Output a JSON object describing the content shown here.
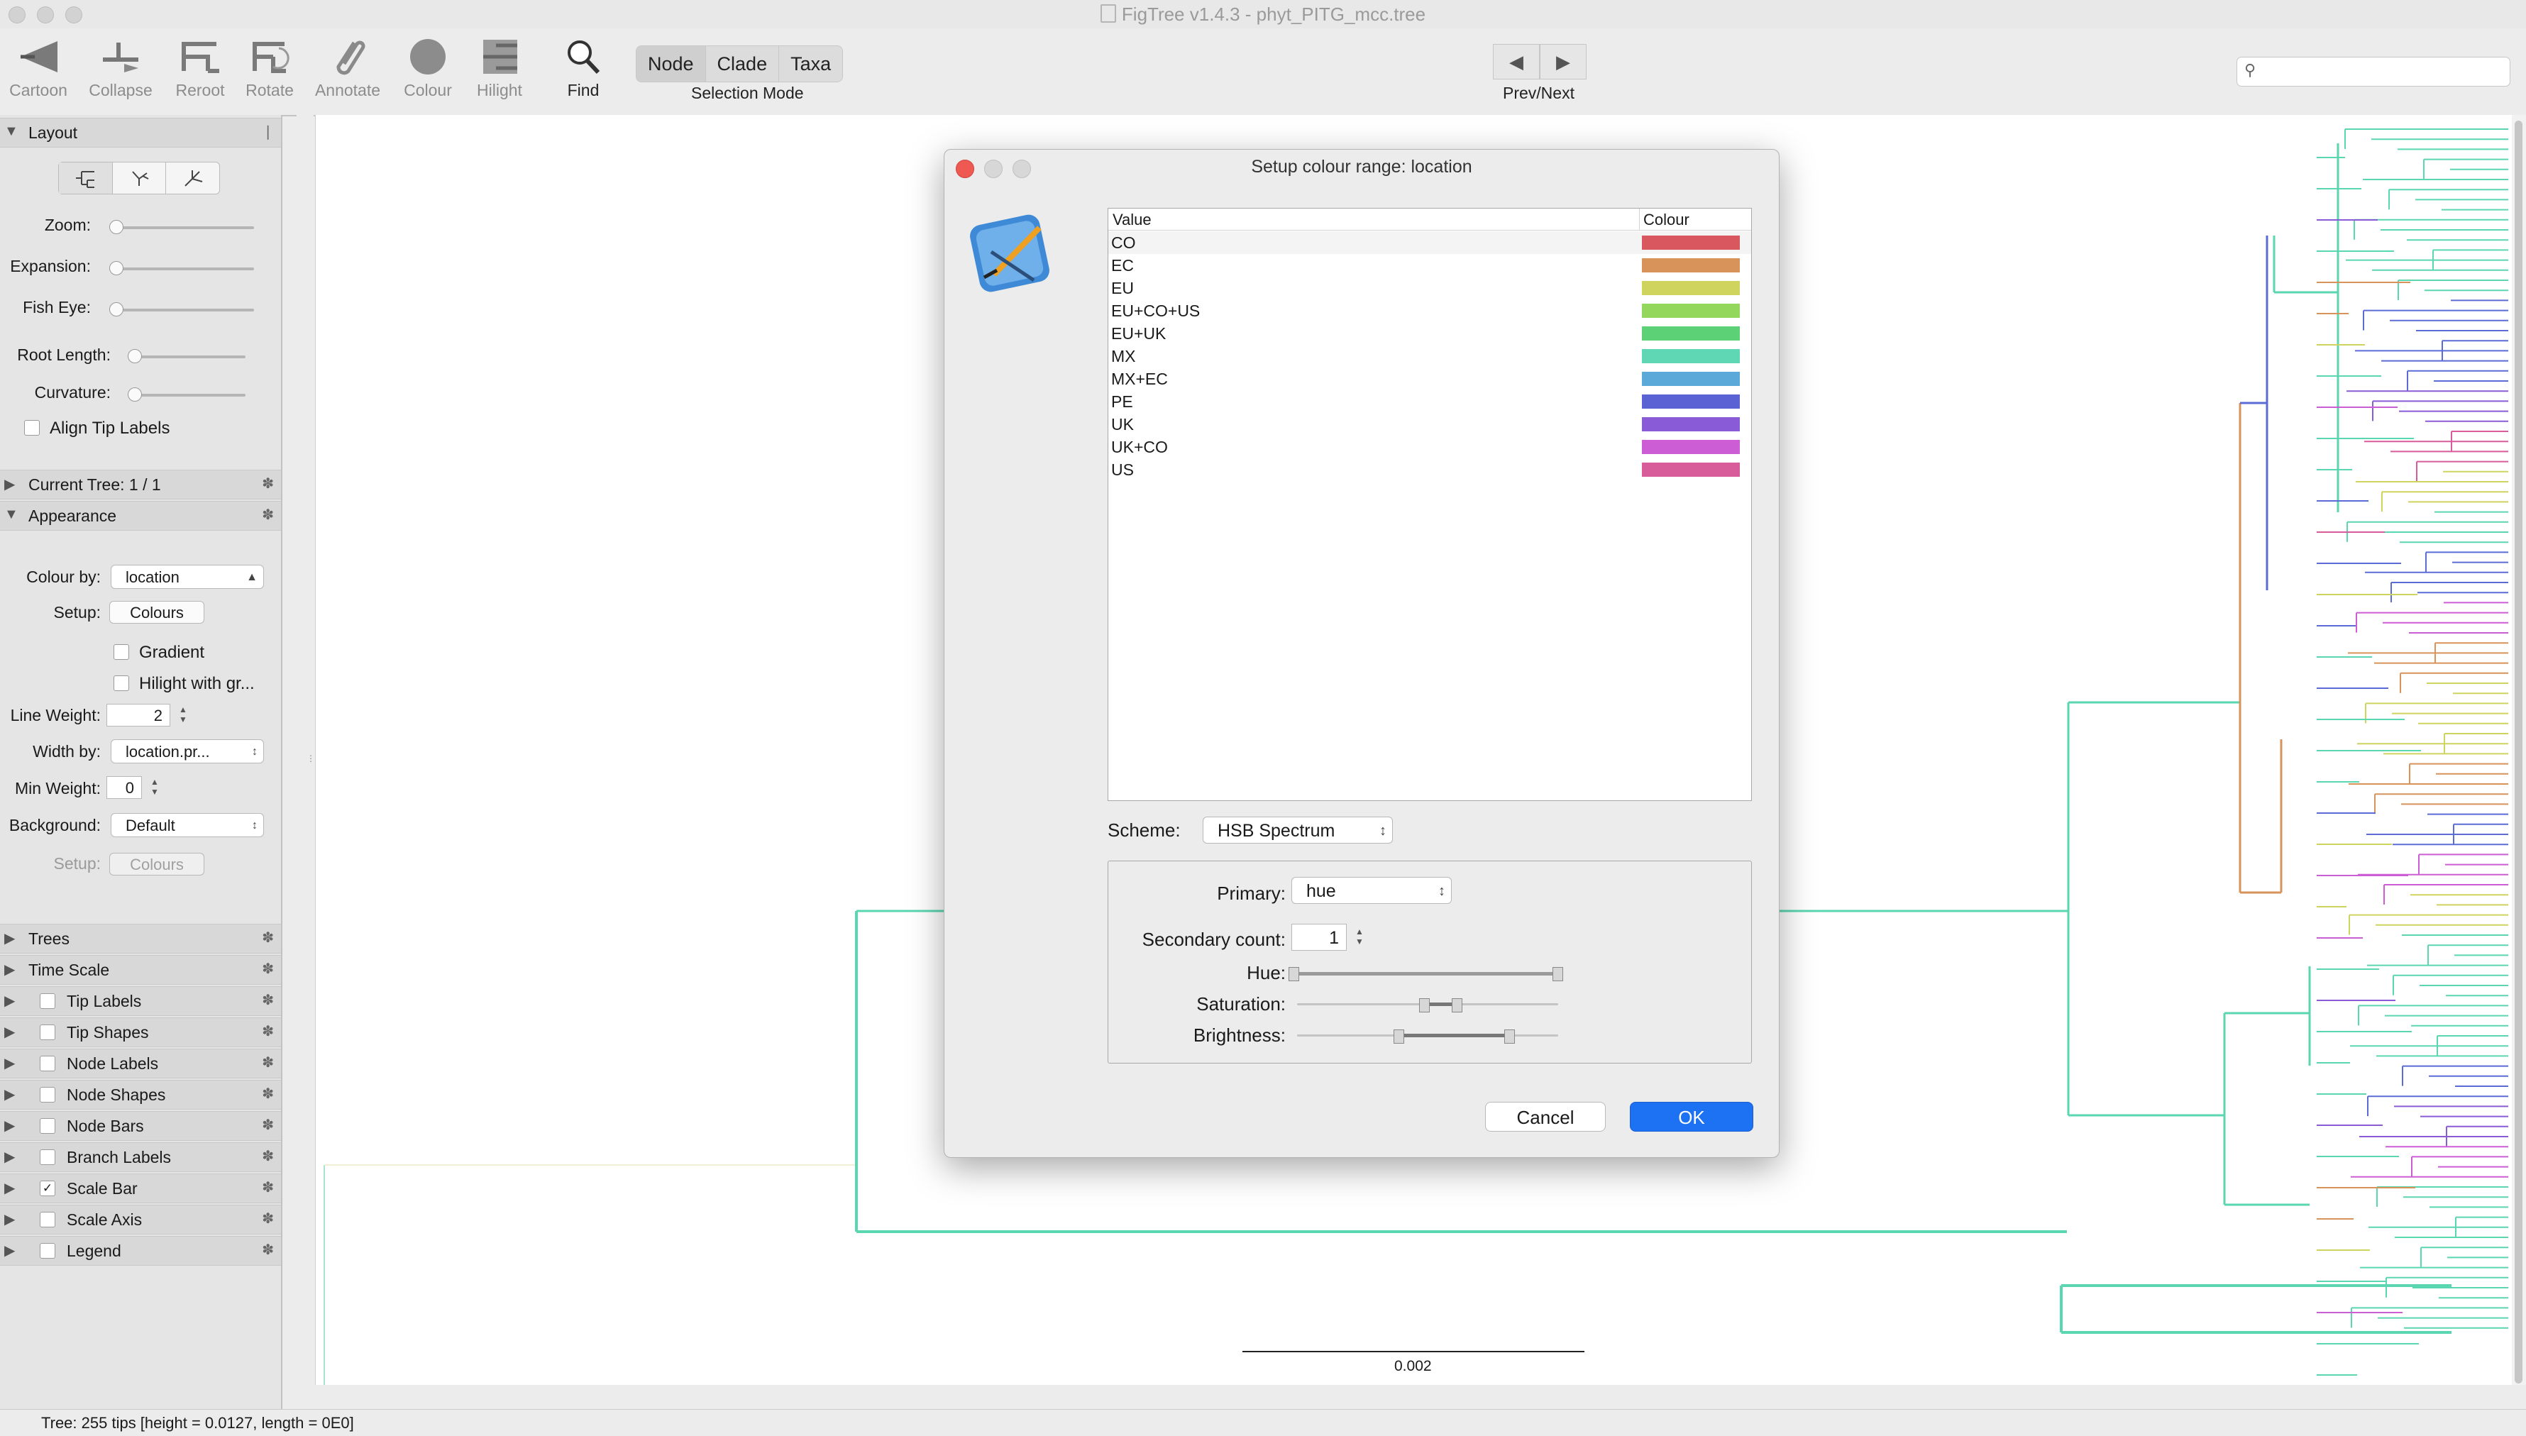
{
  "window": {
    "title": "FigTree v1.4.3 - phyt_PITG_mcc.tree"
  },
  "toolbar": {
    "cartoon": "Cartoon",
    "collapse": "Collapse",
    "reroot": "Reroot",
    "rotate": "Rotate",
    "annotate": "Annotate",
    "colour": "Colour",
    "hilight": "Hilight",
    "find": "Find",
    "selection_tabs": [
      "Node",
      "Clade",
      "Taxa"
    ],
    "selection_mode_label": "Selection Mode",
    "prevnext_label": "Prev/Next",
    "search_placeholder": ""
  },
  "sidebar": {
    "layout_header": "Layout",
    "zoom_label": "Zoom:",
    "expansion_label": "Expansion:",
    "fisheye_label": "Fish Eye:",
    "root_length_label": "Root Length:",
    "curvature_label": "Curvature:",
    "align_tip_labels": "Align Tip Labels",
    "current_tree": "Current Tree: 1 / 1",
    "appearance_header": "Appearance",
    "colour_by_label": "Colour by:",
    "colour_by_value": "location",
    "setup_label": "Setup:",
    "colours_button": "Colours",
    "gradient_label": "Gradient",
    "hilight_label": "Hilight with gr...",
    "line_weight_label": "Line Weight:",
    "line_weight_value": "2",
    "width_by_label": "Width by:",
    "width_by_value": "location.pr...",
    "min_weight_label": "Min Weight:",
    "min_weight_value": "0",
    "background_label": "Background:",
    "background_value": "Default",
    "setup2_label": "Setup:",
    "colours2_button": "Colours",
    "sections": [
      {
        "label": "Trees",
        "checkbox": false,
        "checked": false
      },
      {
        "label": "Time Scale",
        "checkbox": false,
        "checked": false
      },
      {
        "label": "Tip Labels",
        "checkbox": true,
        "checked": false
      },
      {
        "label": "Tip Shapes",
        "checkbox": true,
        "checked": false
      },
      {
        "label": "Node Labels",
        "checkbox": true,
        "checked": false
      },
      {
        "label": "Node Shapes",
        "checkbox": true,
        "checked": false
      },
      {
        "label": "Node Bars",
        "checkbox": true,
        "checked": false
      },
      {
        "label": "Branch Labels",
        "checkbox": true,
        "checked": false
      },
      {
        "label": "Scale Bar",
        "checkbox": true,
        "checked": true
      },
      {
        "label": "Scale Axis",
        "checkbox": true,
        "checked": false
      },
      {
        "label": "Legend",
        "checkbox": true,
        "checked": false
      }
    ]
  },
  "canvas": {
    "scale_label": "0.002"
  },
  "status": {
    "text": "Tree: 255 tips [height = 0.0127, length = 0E0]"
  },
  "dialog": {
    "title": "Setup colour range: location",
    "col_value": "Value",
    "col_colour": "Colour",
    "rows": [
      {
        "value": "CO",
        "color": "#d9585f"
      },
      {
        "value": "EC",
        "color": "#d7935a"
      },
      {
        "value": "EU",
        "color": "#cfd45e"
      },
      {
        "value": "EU+CO+US",
        "color": "#93d75d"
      },
      {
        "value": "EU+UK",
        "color": "#5dd175"
      },
      {
        "value": "MX",
        "color": "#5fd6b4"
      },
      {
        "value": "MX+EC",
        "color": "#5ba9d8"
      },
      {
        "value": "PE",
        "color": "#5b63d4"
      },
      {
        "value": "UK",
        "color": "#8a5bd6"
      },
      {
        "value": "UK+CO",
        "color": "#cd5dd4"
      },
      {
        "value": "US",
        "color": "#d85b9a"
      }
    ],
    "scheme_label": "Scheme:",
    "scheme_value": "HSB Spectrum",
    "primary_label": "Primary:",
    "primary_value": "hue",
    "secondary_count_label": "Secondary count:",
    "secondary_count_value": "1",
    "hue_label": "Hue:",
    "saturation_label": "Saturation:",
    "brightness_label": "Brightness:",
    "cancel": "Cancel",
    "ok": "OK"
  }
}
